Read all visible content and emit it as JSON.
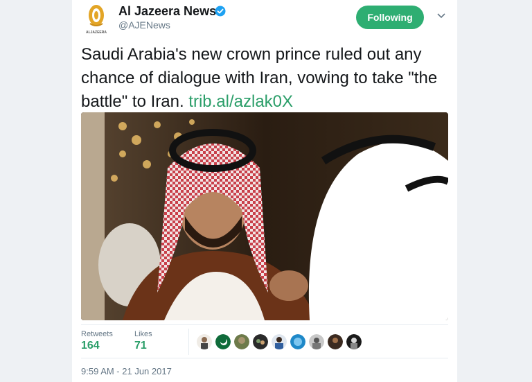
{
  "account": {
    "name": "Al Jazeera News",
    "handle": "@AJENews",
    "logo_text": "ALJAZEERA",
    "verified_icon": "verified-badge-icon"
  },
  "follow_button": {
    "label": "Following"
  },
  "tweet": {
    "text": "Saudi Arabia's new crown prince ruled out any chance of dialogue with Iran, vowing to take \"the battle\" to Iran.",
    "link": "trib.al/azlak0X"
  },
  "stats": {
    "retweets_label": "Retweets",
    "retweets_value": "164",
    "likes_label": "Likes",
    "likes_value": "71"
  },
  "timestamp": "9:59 AM - 21 Jun 2017",
  "colors": {
    "accent": "#2eae72",
    "link": "#2b9e69",
    "verified": "#1da1f2"
  }
}
